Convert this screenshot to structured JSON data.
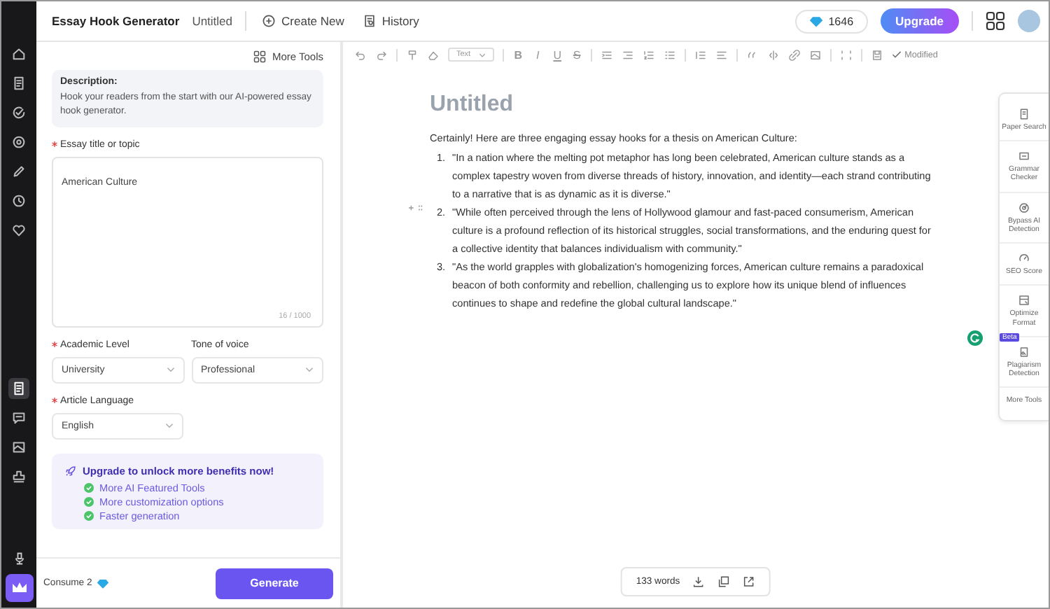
{
  "rail": {
    "top": [
      {
        "kind": "home",
        "selected": false
      },
      {
        "kind": "document",
        "selected": false
      },
      {
        "kind": "check",
        "selected": false
      },
      {
        "kind": "gear",
        "selected": false
      },
      {
        "kind": "pencil",
        "selected": false
      },
      {
        "kind": "clock",
        "selected": false
      },
      {
        "kind": "heart",
        "selected": false
      }
    ],
    "middle": [
      {
        "kind": "document",
        "selected": true
      },
      {
        "kind": "chat",
        "selected": false
      },
      {
        "kind": "image",
        "selected": false
      },
      {
        "kind": "stamp",
        "selected": false
      }
    ]
  },
  "header": {
    "app_name": "Essay Hook Generator",
    "doc_title": "Untitled",
    "create_new": "Create New",
    "history": "History",
    "credits": "1646",
    "upgrade": "Upgrade"
  },
  "form": {
    "more_tools": "More Tools",
    "description_label": "Description:",
    "description": "Hook your readers from the start with our AI-powered essay hook generator.",
    "topic": {
      "label": "Essay title or topic",
      "required": true,
      "value": "American Culture",
      "counter": "16 / 1000"
    },
    "academic_level": {
      "label": "Academic Level",
      "required": true,
      "value": "University"
    },
    "tone": {
      "label": "Tone of voice",
      "required": false,
      "value": "Professional"
    },
    "language": {
      "label": "Article Language",
      "required": true,
      "value": "English"
    },
    "upgrade_box": {
      "title": "Upgrade to unlock more benefits now!",
      "items": [
        "More AI Featured Tools",
        "More customization options",
        "Faster generation"
      ]
    },
    "consume": "Consume 2",
    "generate": "Generate"
  },
  "editor": {
    "toolbar": [
      {
        "kind": "undo"
      },
      {
        "kind": "redo"
      },
      {
        "kind": "separator"
      },
      {
        "kind": "paint"
      },
      {
        "kind": "eraser"
      },
      {
        "kind": "style",
        "label": "Text"
      },
      {
        "kind": "separator"
      },
      {
        "kind": "bold",
        "label": "B"
      },
      {
        "kind": "italic",
        "label": "I"
      },
      {
        "kind": "underline",
        "label": "U"
      },
      {
        "kind": "strike",
        "label": "S"
      },
      {
        "kind": "separator"
      },
      {
        "kind": "indent"
      },
      {
        "kind": "outdent"
      },
      {
        "kind": "ordered"
      },
      {
        "kind": "bullets"
      },
      {
        "kind": "separator"
      },
      {
        "kind": "spacing"
      },
      {
        "kind": "align"
      },
      {
        "kind": "separator"
      },
      {
        "kind": "quote"
      },
      {
        "kind": "code"
      },
      {
        "kind": "link"
      },
      {
        "kind": "image"
      },
      {
        "kind": "separator"
      },
      {
        "kind": "expand"
      },
      {
        "kind": "separator"
      },
      {
        "kind": "save"
      },
      {
        "kind": "status",
        "label": "Modified"
      }
    ],
    "title": "Untitled",
    "intro": "Certainly! Here are three engaging essay hooks for a thesis on American Culture:",
    "hooks": [
      {
        "number": "1.",
        "text": "\"In a nation where the melting pot metaphor has long been celebrated, American culture stands as a complex tapestry woven from diverse threads of history, innovation, and identity—each strand contributing to a narrative that is as dynamic as it is diverse.\""
      },
      {
        "number": "2.",
        "text": "\"While often perceived through the lens of Hollywood glamour and fast-paced consumerism, American culture is a profound reflection of its historical struggles, social transformations, and the enduring quest for a collective identity that balances individualism with community.\""
      },
      {
        "number": "3.",
        "text": "\"As the world grapples with globalization's homogenizing forces, American culture remains a paradoxical beacon of both conformity and rebellion, challenging us to explore how its unique blend of influences continues to shape and redefine the global cultural landscape.\""
      }
    ],
    "word_count": "133 words"
  },
  "tools": [
    {
      "kind": "paper",
      "label": "Paper Search"
    },
    {
      "kind": "grammar",
      "label": "Grammar Checker"
    },
    {
      "kind": "target",
      "label": "Bypass AI Detection"
    },
    {
      "kind": "gauge",
      "label": "SEO Score"
    },
    {
      "kind": "format",
      "label": "Optimize Format"
    },
    {
      "kind": "plagiarism",
      "label": "Plagiarism Detection",
      "badge": "Beta"
    },
    {
      "kind": "more",
      "label": "More Tools"
    }
  ]
}
